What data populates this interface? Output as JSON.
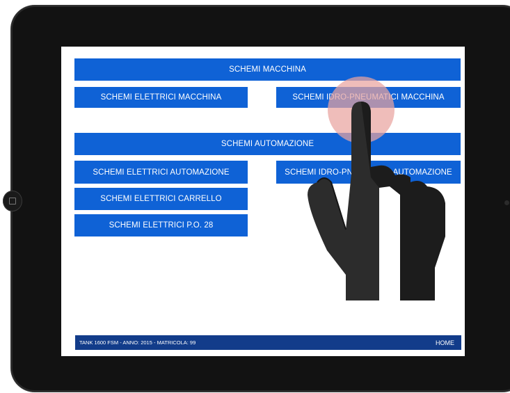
{
  "sections": {
    "macchina": {
      "header": "SCHEMI MACCHINA",
      "buttons": {
        "elettrici": "SCHEMI ELETTRICI MACCHINA",
        "idro": "SCHEMI IDRO-PNEUMATICI MACCHINA"
      }
    },
    "automazione": {
      "header": "SCHEMI AUTOMAZIONE",
      "buttons": {
        "elettrici": "SCHEMI ELETTRICI AUTOMAZIONE",
        "idro": "SCHEMI IDRO-PNEUMATICI AUTOMAZIONE",
        "carrello": "SCHEMI ELETTRICI CARRELLO",
        "po28": "SCHEMI ELETTRICI P.O. 28"
      }
    }
  },
  "footer": {
    "info": "TANK 1600 FSM - ANNO: 2015 - MATRICOLA: 99",
    "home": "HOME"
  },
  "colors": {
    "button_blue": "#0f62d6",
    "footer_blue": "#123c8a",
    "touch_highlight": "#f2b8b4"
  },
  "icons": {
    "pointer": "hand-pointer-icon"
  }
}
